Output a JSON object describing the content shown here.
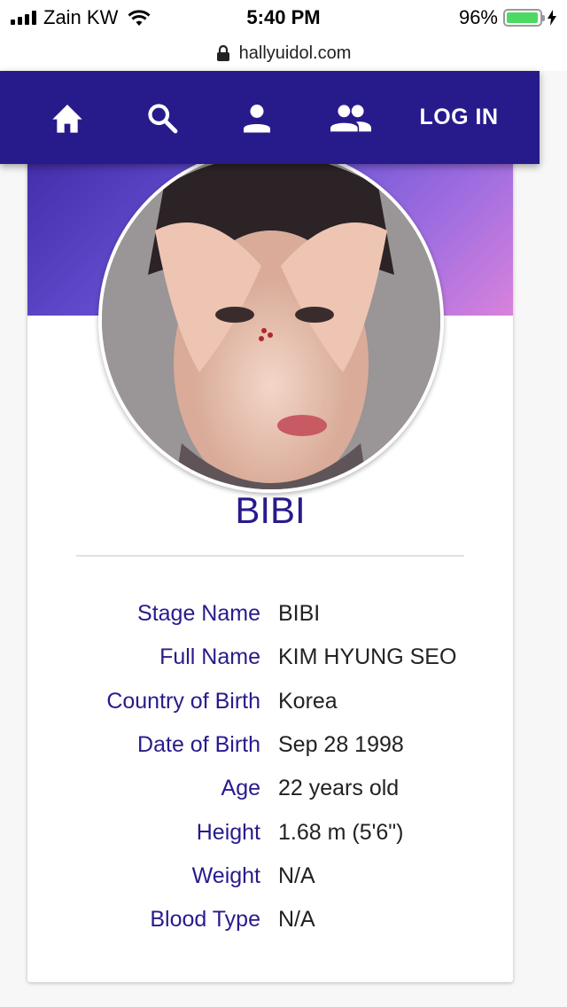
{
  "status_bar": {
    "carrier": "Zain KW",
    "time": "5:40 PM",
    "battery_percent": "96%",
    "battery_level": 0.96
  },
  "browser": {
    "url": "hallyuidol.com"
  },
  "nav": {
    "home_icon": "home-icon",
    "search_icon": "search-icon",
    "person_icon": "person-icon",
    "group_icon": "group-icon",
    "login_label": "LOG IN"
  },
  "profile": {
    "name": "BIBI",
    "fields": [
      {
        "label": "Stage Name",
        "value": "BIBI"
      },
      {
        "label": "Full Name",
        "value": "KIM HYUNG SEO"
      },
      {
        "label": "Country of Birth",
        "value": "Korea"
      },
      {
        "label": "Date of Birth",
        "value": "Sep 28 1998"
      },
      {
        "label": "Age",
        "value": "22 years old"
      },
      {
        "label": "Height",
        "value": "1.68 m (5'6\")"
      },
      {
        "label": "Weight",
        "value": "N/A"
      },
      {
        "label": "Blood Type",
        "value": "N/A"
      }
    ]
  },
  "colors": {
    "primary": "#271b8c",
    "banner_start": "#3f2aa6",
    "banner_end": "#d982dc",
    "battery": "#4cd964"
  }
}
